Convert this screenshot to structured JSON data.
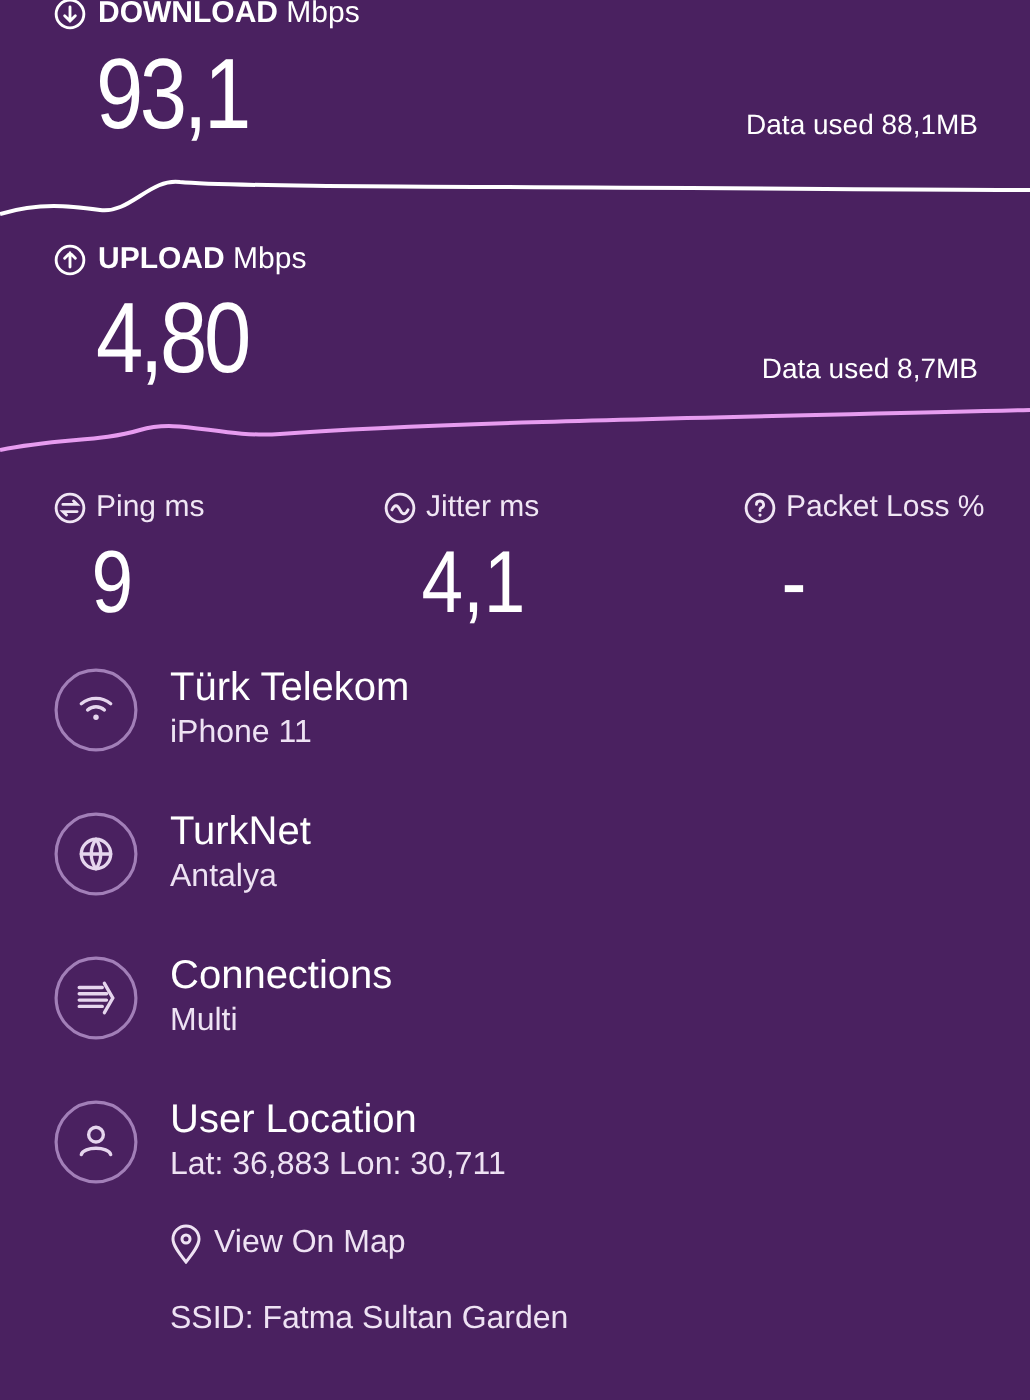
{
  "speeds": [
    {
      "kind": "download",
      "label": "DOWNLOAD",
      "unit": "Mbps",
      "value": "93,1",
      "data_used": "Data used 88,1MB"
    },
    {
      "kind": "upload",
      "label": "UPLOAD",
      "unit": "Mbps",
      "value": "4,80",
      "data_used": "Data used 8,7MB"
    }
  ],
  "metrics": [
    {
      "kind": "ping",
      "label": "Ping",
      "unit": "ms",
      "value": "9"
    },
    {
      "kind": "jitter",
      "label": "Jitter",
      "unit": "ms",
      "value": "4,1"
    },
    {
      "kind": "loss",
      "label": "Packet Loss %",
      "value": "-"
    }
  ],
  "details": [
    {
      "kind": "wifi",
      "title": "Türk Telekom",
      "subtitle": "iPhone 11"
    },
    {
      "kind": "globe",
      "title": "TurkNet",
      "subtitle": "Antalya"
    },
    {
      "kind": "connections",
      "title": "Connections",
      "subtitle": "Multi"
    },
    {
      "kind": "user",
      "title": "User Location",
      "subtitle": "Lat: 36,883  Lon: 30,711"
    }
  ],
  "map_link": "View On Map",
  "ssid": "SSID: Fatma Sultan Garden"
}
